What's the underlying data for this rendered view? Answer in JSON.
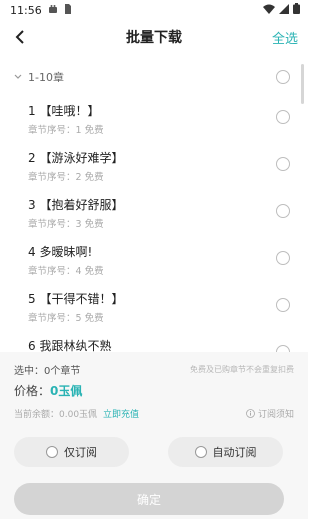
{
  "status_bar": {
    "time": "11:56"
  },
  "header": {
    "title": "批量下载",
    "select_all": "全选"
  },
  "group": {
    "label": "1-10章"
  },
  "chapters": [
    {
      "name": "1 【哇哦！】",
      "meta": "章节序号：1    免费"
    },
    {
      "name": "2 【游泳好难学】",
      "meta": "章节序号：2    免费"
    },
    {
      "name": "3 【抱着好舒服】",
      "meta": "章节序号：3    免费"
    },
    {
      "name": "4 多暧昧啊!",
      "meta": "章节序号：4    免费"
    },
    {
      "name": "5 【干得不错！】",
      "meta": "章节序号：5    免费"
    },
    {
      "name": "6 我跟林纨不熟",
      "meta": ""
    }
  ],
  "summary": {
    "selected": "选中：0个章节",
    "note": "免费及已购章节不会重复扣费",
    "price_label": "价格：",
    "price": "0玉佩",
    "balance": "当前余额：0.00玉佩",
    "recharge": "立即充值",
    "notice": "订阅须知"
  },
  "buttons": {
    "subscribe_only": "仅订阅",
    "auto_subscribe": "自动订阅",
    "confirm": "确定"
  },
  "colors": {
    "accent": "#2ab3b4",
    "disabled": "#d4d4d4"
  }
}
